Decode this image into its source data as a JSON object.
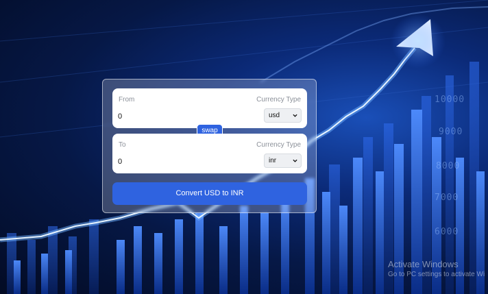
{
  "converter": {
    "from": {
      "label": "From",
      "currency_type_label": "Currency Type",
      "amount": "0",
      "currency": "usd"
    },
    "to": {
      "label": "To",
      "currency_type_label": "Currency Type",
      "amount": "0",
      "currency": "inr"
    },
    "swap_label": "swap",
    "convert_label": "Convert USD to INR"
  },
  "background": {
    "axis_labels": [
      "10000",
      "9000",
      "8000",
      "7000",
      "6000"
    ]
  },
  "watermark": {
    "title": "Activate Windows",
    "subtitle": "Go to PC settings to activate Wi"
  },
  "colors": {
    "accent": "#2f63e0",
    "card_background": "rgba(255,255,255,0.22)",
    "box_background": "#ffffff"
  }
}
